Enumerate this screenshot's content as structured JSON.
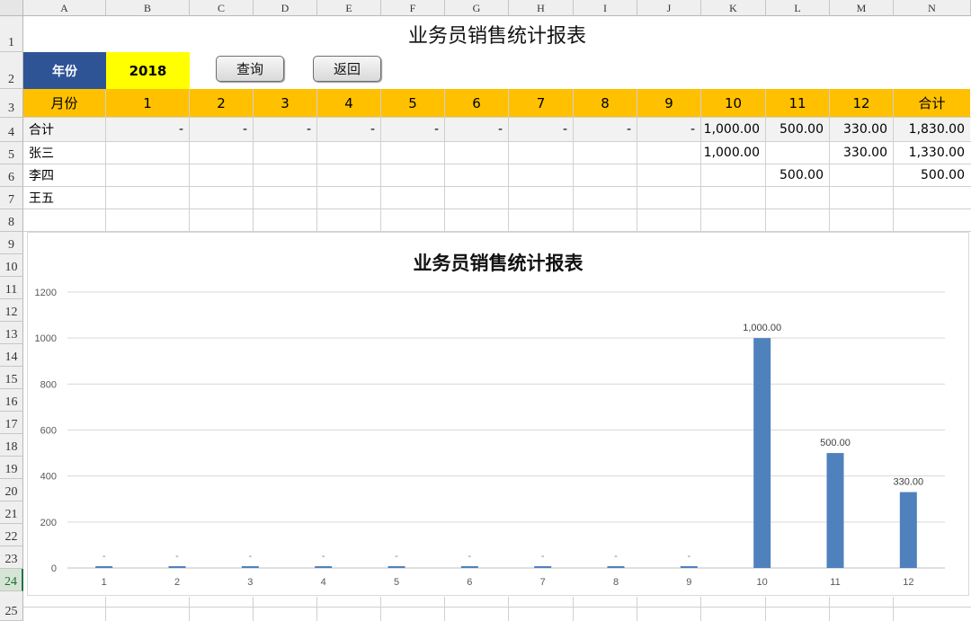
{
  "sheet": {
    "columns": [
      "A",
      "B",
      "C",
      "D",
      "E",
      "F",
      "G",
      "H",
      "I",
      "J",
      "K",
      "L",
      "M",
      "N"
    ],
    "rows": [
      "1",
      "2",
      "3",
      "4",
      "5",
      "6",
      "7",
      "8",
      "9",
      "10",
      "11",
      "12",
      "13",
      "14",
      "15",
      "16",
      "17",
      "18",
      "19",
      "20",
      "21",
      "22",
      "23",
      "24",
      "25"
    ],
    "active_row": "24"
  },
  "report": {
    "title": "业务员销售统计报表",
    "year_label": "年份",
    "year_value": "2018",
    "query_button": "查询",
    "back_button": "返回"
  },
  "table": {
    "header": [
      "月份",
      "1",
      "2",
      "3",
      "4",
      "5",
      "6",
      "7",
      "8",
      "9",
      "10",
      "11",
      "12",
      "合计"
    ],
    "rows": [
      {
        "name": "合计",
        "cells": [
          "-",
          "-",
          "-",
          "-",
          "-",
          "-",
          "-",
          "-",
          "-",
          "1,000.00",
          "500.00",
          "330.00",
          "1,830.00"
        ]
      },
      {
        "name": "张三",
        "cells": [
          "",
          "",
          "",
          "",
          "",
          "",
          "",
          "",
          "",
          "1,000.00",
          "",
          "330.00",
          "1,330.00"
        ]
      },
      {
        "name": "李四",
        "cells": [
          "",
          "",
          "",
          "",
          "",
          "",
          "",
          "",
          "",
          "",
          "500.00",
          "",
          "500.00"
        ]
      },
      {
        "name": "王五",
        "cells": [
          "",
          "",
          "",
          "",
          "",
          "",
          "",
          "",
          "",
          "",
          "",
          "",
          ""
        ]
      }
    ]
  },
  "chart_data": {
    "type": "bar",
    "title": "业务员销售统计报表",
    "categories": [
      "1",
      "2",
      "3",
      "4",
      "5",
      "6",
      "7",
      "8",
      "9",
      "10",
      "11",
      "12"
    ],
    "values": [
      0,
      0,
      0,
      0,
      0,
      0,
      0,
      0,
      0,
      1000,
      500,
      330
    ],
    "data_labels": [
      "-",
      "-",
      "-",
      "-",
      "-",
      "-",
      "-",
      "-",
      "-",
      "1,000.00",
      "500.00",
      "330.00"
    ],
    "yticks": [
      "0",
      "200",
      "400",
      "600",
      "800",
      "1000",
      "1200"
    ],
    "ylim": [
      0,
      1200
    ],
    "grid": true,
    "bar_color": "#4f81bd"
  }
}
